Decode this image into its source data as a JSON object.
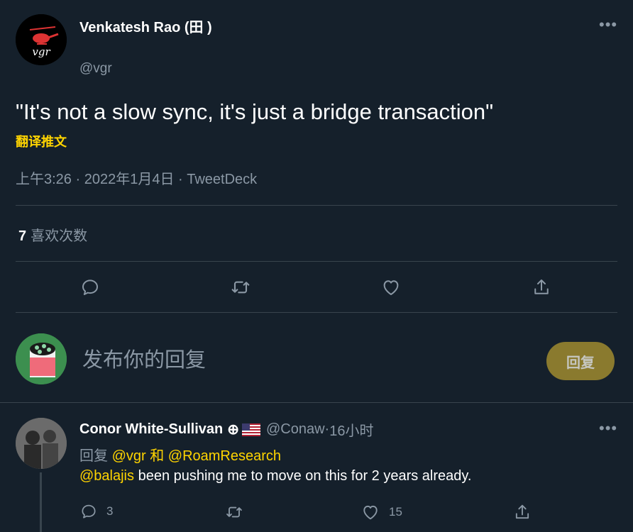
{
  "tweet": {
    "author_name": "Venkatesh Rao (田 )",
    "author_handle": "@vgr",
    "avatar_text": "vgr",
    "text": "\"It's not a slow sync, it's just a bridge transaction\"",
    "translate_label": "翻译推文",
    "time": "上午3:26",
    "date": "2022年1月4日",
    "source": "TweetDeck",
    "separator": " · ",
    "likes_count": "7",
    "likes_label": "喜欢次数"
  },
  "composer": {
    "placeholder": "发布你的回复",
    "reply_button": "回复"
  },
  "reply": {
    "author_name": "Conor White-Sullivan",
    "badge": "⊕",
    "handle": "@Conaw",
    "time": "16小时",
    "separator": " · ",
    "replying_prefix": "回复",
    "replying_to_1": "@vgr",
    "replying_and": "和",
    "replying_to_2": "@RoamResearch",
    "mention": "@balajis",
    "text": " been pushing me to move on this for 2 years already.",
    "reply_count": "3",
    "like_count": "15"
  },
  "icons": {
    "more": "more-icon",
    "reply": "reply-icon",
    "retweet": "retweet-icon",
    "like": "heart-icon",
    "share": "share-icon",
    "flag": "us-flag-icon"
  },
  "colors": {
    "background": "#15202b",
    "accent": "#ffd400",
    "muted": "#8b98a5",
    "divider": "#38444d",
    "reply_button_bg": "#8a7a2e"
  }
}
